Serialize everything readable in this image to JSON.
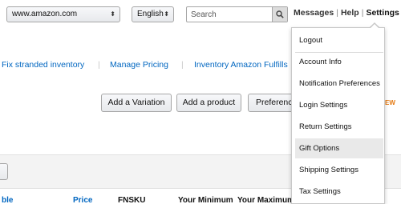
{
  "top_bar": {
    "marketplace": "www.amazon.com",
    "language": "English",
    "search_placeholder": "Search",
    "links": [
      "Messages",
      "Help",
      "Settings"
    ]
  },
  "nav_links": [
    "Fix stranded inventory",
    "Manage Pricing",
    "Inventory Amazon Fulfills"
  ],
  "buttons": {
    "add_variation": "Add a Variation",
    "add_product": "Add a product",
    "preference": "Preferences"
  },
  "new_badge": "EW",
  "table_headers": [
    "ble",
    "Price",
    "FNSKU",
    "Your Minimum",
    "Your Maximum"
  ],
  "settings_menu": {
    "items": [
      "Logout",
      "Account Info",
      "Notification Preferences",
      "Login Settings",
      "Return Settings",
      "Gift Options",
      "Shipping Settings",
      "Tax Settings"
    ],
    "highlighted": "Gift Options"
  },
  "icons": {
    "search_button": "search-icon",
    "select_arrows": "updown-arrows-icon"
  }
}
